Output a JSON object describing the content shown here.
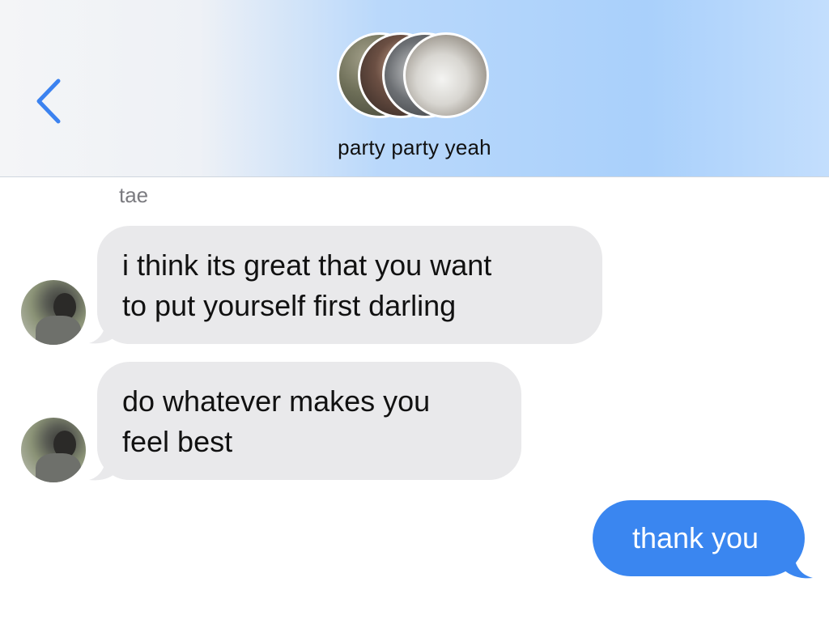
{
  "header": {
    "back_icon": "chevron-left-icon",
    "group_name": "party party yeah",
    "accent_color": "#3b82f0"
  },
  "thread": {
    "sender_name": "tae",
    "incoming": [
      {
        "lines": [
          "i think its great that you want",
          "to put yourself first darling"
        ]
      },
      {
        "lines": [
          "do whatever makes you",
          "feel best"
        ]
      }
    ],
    "outgoing": [
      {
        "text": "thank you"
      }
    ],
    "incoming_bubble_color": "#e9e9eb",
    "outgoing_bubble_color": "#3a86f0"
  }
}
